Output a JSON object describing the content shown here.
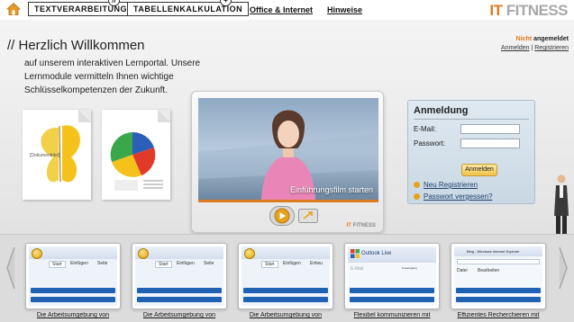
{
  "header": {
    "tabs": [
      {
        "label": "TEXTVERARBEITUNG",
        "badge": "//"
      },
      {
        "label": "TABELLENKALKULATION",
        "badge": "+"
      }
    ],
    "links": [
      "Office & Internet",
      "Hinweise"
    ],
    "logo": {
      "part1": "IT",
      "part2": "FITNESS"
    }
  },
  "status": {
    "not": "Nicht",
    "state": "angemeldet",
    "login_link": "Anmelden",
    "separator": "|",
    "register_link": "Registrieren"
  },
  "welcome": {
    "title": "// Herzlich Willkommen",
    "text": "auf unserem interaktiven Lernportal. Unsere Lernmodule vermitteln Ihnen wichtige Schlüsselkompetenzen der Zukunft."
  },
  "documents": {
    "doc_a_caption": "[Dokumenttitel]"
  },
  "video": {
    "caption": "Einführungsfilm starten",
    "logo_it": "IT",
    "logo_fitness": "FITNESS"
  },
  "login": {
    "title": "Anmeldung",
    "email_label": "E-Mail:",
    "password_label": "Passwort:",
    "email_value": "",
    "password_value": "",
    "button": "Anmelden",
    "register": "Neu Registrieren",
    "forgot": "Passwort vergessen?"
  },
  "modules": [
    {
      "caption": "Die Arbeitsumgebung von",
      "tabs": [
        "Start",
        "Einfügen",
        "Seite"
      ]
    },
    {
      "caption": "Die Arbeitsumgebung von",
      "tabs": [
        "Start",
        "Einfügen",
        "Seite"
      ]
    },
    {
      "caption": "Die Arbeitsumgebung von",
      "tabs": [
        "Start",
        "Einfügen",
        "Entwu"
      ]
    },
    {
      "caption": "Flexibel kommunizieren mit",
      "tabs": [
        "Outlook Live",
        "E-Mail",
        "Posteingang"
      ]
    },
    {
      "caption": "Effizientes Recherchieren mit",
      "tabs": [
        "Bing - Windows Internet Explorer",
        "Datei",
        "Bearbeiten"
      ]
    }
  ],
  "colors": {
    "accent": "#e07a1f",
    "progress": "#1f62b3"
  }
}
